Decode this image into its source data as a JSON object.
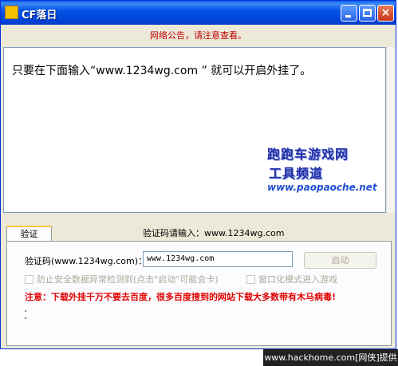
{
  "window": {
    "title": "CF落日",
    "app_icon_text": "王者\n辅助"
  },
  "titlebar_buttons": {
    "minimize": "minimize",
    "maximize": "maximize",
    "close": "×"
  },
  "notice": "网络公告，请注意查看。",
  "content": {
    "message": "只要在下面输入“www.1234wg.com ” 就可以开启外挂了。",
    "watermark": {
      "line1": "跑跑车游戏网",
      "line2": "工具频道",
      "url": "www.paopaoche.net"
    }
  },
  "panel": {
    "tab_label": "验证",
    "prompt": "验证码请输入：www.1234wg.com",
    "code_label": "验证码(www.1234wg.com)：",
    "code_value": "www.1234wg.com",
    "start_button": "启动",
    "checkbox1": "防止安全数据异常检测到(点击\"启动\"可能会卡)",
    "checkbox2": "窗口化模式进入游戏",
    "warning": "注意：下载外挂千万不要去百度，很多百度搜到的网站下载大多数带有木马病毒!"
  },
  "footer": "www.hackhome.com[网侠]提供",
  "colors": {
    "titlebar": "#0453e6",
    "notice": "#c00000",
    "warning": "#e00000",
    "watermark": "#1f2fa8"
  }
}
